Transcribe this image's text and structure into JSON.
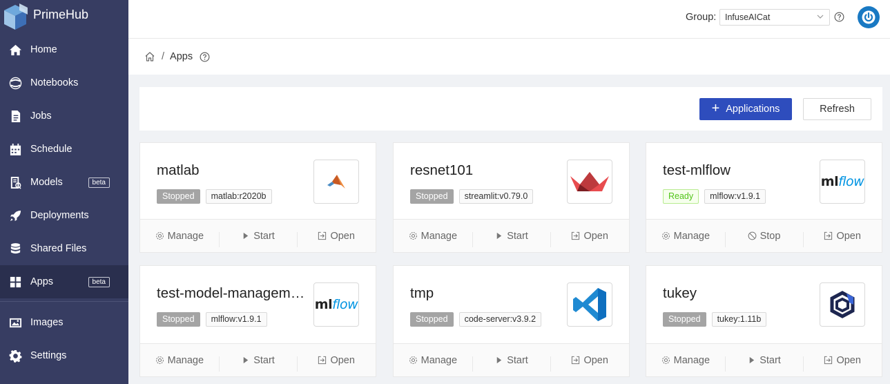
{
  "app": {
    "name": "PrimeHub"
  },
  "sidebar": {
    "items": [
      {
        "label": "Home",
        "icon": "home-icon"
      },
      {
        "label": "Notebooks",
        "icon": "jupyter-icon"
      },
      {
        "label": "Jobs",
        "icon": "jobs-icon"
      },
      {
        "label": "Schedule",
        "icon": "calendar-icon"
      },
      {
        "label": "Models",
        "icon": "models-icon",
        "badge": "beta"
      },
      {
        "label": "Deployments",
        "icon": "rocket-icon"
      },
      {
        "label": "Shared Files",
        "icon": "database-icon"
      },
      {
        "label": "Apps",
        "icon": "apps-icon",
        "badge": "beta",
        "active": true
      },
      {
        "label": "Images",
        "icon": "image-icon"
      },
      {
        "label": "Settings",
        "icon": "gear-icon"
      }
    ]
  },
  "header": {
    "group_label": "Group:",
    "group_value": "InfuseAICat"
  },
  "breadcrumb": {
    "separator": "/",
    "current": "Apps"
  },
  "toolbar": {
    "add_label": "Applications",
    "refresh_label": "Refresh"
  },
  "apps": [
    {
      "name": "matlab",
      "status": "Stopped",
      "image": "matlab:r2020b",
      "logo": "matlab-logo",
      "actions": [
        "Manage",
        "Start",
        "Open"
      ]
    },
    {
      "name": "resnet101",
      "status": "Stopped",
      "image": "streamlit:v0.79.0",
      "logo": "streamlit-logo",
      "actions": [
        "Manage",
        "Start",
        "Open"
      ]
    },
    {
      "name": "test-mlflow",
      "status": "Ready",
      "image": "mlflow:v1.9.1",
      "logo": "mlflow-logo",
      "actions": [
        "Manage",
        "Stop",
        "Open"
      ]
    },
    {
      "name": "test-model-management",
      "status": "Stopped",
      "image": "mlflow:v1.9.1",
      "logo": "mlflow-logo",
      "actions": [
        "Manage",
        "Start",
        "Open"
      ]
    },
    {
      "name": "tmp",
      "status": "Stopped",
      "image": "code-server:v3.9.2",
      "logo": "vscode-logo",
      "actions": [
        "Manage",
        "Start",
        "Open"
      ]
    },
    {
      "name": "tukey",
      "status": "Stopped",
      "image": "tukey:1.11b",
      "logo": "tukey-logo",
      "actions": [
        "Manage",
        "Start",
        "Open"
      ]
    }
  ],
  "logo_text": {
    "ml": "ml",
    "flow": "flow"
  },
  "colors": {
    "sidebar": "#373d62",
    "primary": "#2e4dbd",
    "ready": "#52c41a",
    "stopped": "#a4a4a4"
  }
}
